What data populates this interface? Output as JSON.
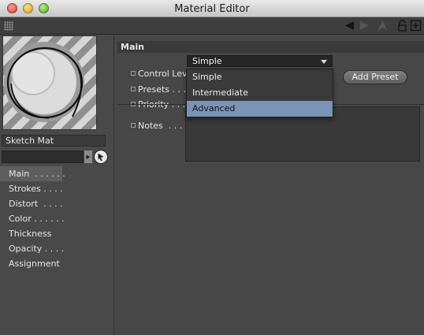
{
  "window": {
    "title": "Material Editor"
  },
  "toolbar": {
    "icons": [
      "grip-icon",
      "back-arrow-icon",
      "forward-arrow-icon",
      "up-arrow-icon",
      "lock-icon",
      "new-window-icon"
    ]
  },
  "sidebar": {
    "material_name": "Sketch Mat",
    "filter_value": "",
    "items": [
      {
        "label": "Main  . . . . . .",
        "active": true
      },
      {
        "label": "Strokes . . . ."
      },
      {
        "label": "Distort  . . . ."
      },
      {
        "label": "Color . . . . . ."
      },
      {
        "label": "Thickness"
      },
      {
        "label": "Opacity . . . ."
      },
      {
        "label": "Assignment"
      }
    ]
  },
  "main": {
    "section_title": "Main",
    "control_level": {
      "label": "Control Level",
      "value": "Simple"
    },
    "presets": {
      "label": "Presets . . . . ."
    },
    "priority": {
      "label": "Priority . . . . ."
    },
    "notes": {
      "label": "Notes  . . . . . ."
    },
    "add_preset_label": "Add Preset"
  },
  "dropdown": {
    "options": [
      "Simple",
      "Intermediate",
      "Advanced"
    ],
    "highlighted": "Advanced"
  },
  "colors": {
    "panel_bg": "#474747",
    "selection": "#7a93b8",
    "header_bg": "#3a3a3a"
  }
}
